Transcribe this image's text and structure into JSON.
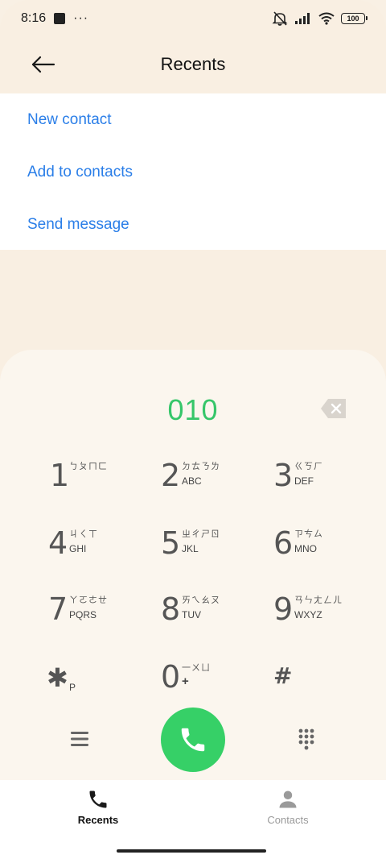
{
  "status_bar": {
    "time": "8:16",
    "more": "···",
    "battery": "100",
    "icons": [
      "app-notification-icon",
      "mute-icon",
      "signal-icon",
      "wifi-icon",
      "battery-icon"
    ]
  },
  "header": {
    "title": "Recents",
    "back_icon": "back-arrow-icon"
  },
  "menu": {
    "items": [
      {
        "label": "New contact"
      },
      {
        "label": "Add to contacts"
      },
      {
        "label": "Send message"
      }
    ],
    "color": "#2a7ee8"
  },
  "dialer": {
    "number": "010",
    "number_color": "#36c66a",
    "backspace_icon": "backspace-icon",
    "keys": [
      {
        "digit": "1",
        "top": "ㄅㄆㄇㄈ",
        "bottom": ""
      },
      {
        "digit": "2",
        "top": "ㄉㄊㄋㄌ",
        "bottom": "ABC"
      },
      {
        "digit": "3",
        "top": "ㄍㄎㄏ",
        "bottom": "DEF"
      },
      {
        "digit": "4",
        "top": "ㄐㄑㄒ",
        "bottom": "GHI"
      },
      {
        "digit": "5",
        "top": "ㄓㄔㄕㄖ",
        "bottom": "JKL"
      },
      {
        "digit": "6",
        "top": "ㄗㄘㄙ",
        "bottom": "MNO"
      },
      {
        "digit": "7",
        "top": "ㄚㄛㄜㄝ",
        "bottom": "PQRS"
      },
      {
        "digit": "8",
        "top": "ㄞㄟㄠㄡ",
        "bottom": "TUV"
      },
      {
        "digit": "9",
        "top": "ㄢㄣㄤㄥㄦ",
        "bottom": "WXYZ"
      },
      {
        "digit": "✱",
        "top": "",
        "bottom": "P"
      },
      {
        "digit": "0",
        "top": "一ㄨㄩ",
        "bottom": "+"
      },
      {
        "digit": "#",
        "top": "",
        "bottom": ""
      }
    ],
    "call_color": "#36d067",
    "menu_icon": "hamburger-menu-icon",
    "keypad_icon": "keypad-grid-icon",
    "call_icon": "phone-icon"
  },
  "tabs": [
    {
      "label": "Recents",
      "icon": "phone-icon",
      "active": true
    },
    {
      "label": "Contacts",
      "icon": "person-icon",
      "active": false
    }
  ]
}
